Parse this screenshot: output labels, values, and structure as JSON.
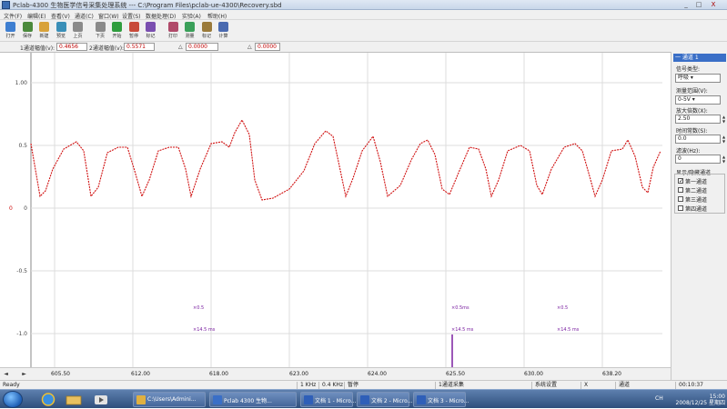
{
  "window": {
    "title": "Pclab-4300 生物医学信号采集处理系统 --- C:\\Program Files\\pclab-ue-4300\\Recovery.sbd",
    "minimize": "_",
    "maximize": "□",
    "close": "X"
  },
  "menu": [
    "文件(F)",
    "编辑(E)",
    "查看(V)",
    "通道(C)",
    "窗口(W)",
    "设置(S)",
    "数据处理(D)",
    "实验(A)",
    "帮助(H)"
  ],
  "toolbar": [
    {
      "label": "打开",
      "icon": "open-icon",
      "color": "#3f7fd1"
    },
    {
      "label": "保存",
      "icon": "save-icon",
      "color": "#4b8a3c"
    },
    {
      "label": "新建",
      "icon": "new-icon",
      "color": "#d8a23a"
    },
    {
      "label": "预览",
      "icon": "preview-icon",
      "color": "#3a8fb8"
    },
    {
      "label": "上页",
      "icon": "prev-page-icon",
      "color": "#8a8a8a"
    },
    {
      "label": "下页",
      "icon": "next-page-icon",
      "color": "#8a8a8a"
    },
    {
      "label": "开始",
      "icon": "start-icon",
      "color": "#2f9d3e"
    },
    {
      "label": "暂停",
      "icon": "pause-icon",
      "color": "#c84a3a"
    },
    {
      "label": "标记",
      "icon": "mark-icon",
      "color": "#7a4fb0"
    },
    {
      "label": "打印",
      "icon": "print-icon",
      "color": "#b04a6a"
    },
    {
      "label": "测量",
      "icon": "measure-icon",
      "color": "#3aa05a"
    },
    {
      "label": "标记",
      "icon": "flag-icon",
      "color": "#9a7a3a"
    },
    {
      "label": "计算",
      "icon": "calc-icon",
      "color": "#4a6ab0"
    }
  ],
  "params": {
    "channel_label": "1通道幅值(v):",
    "channel_value": "0.4656",
    "sample_label": "2通道幅值(v):",
    "sample_value": "0.5571",
    "field3_label": "△",
    "field3_value": "0.0000",
    "field4_label": "△",
    "field4_value": "0.0000"
  },
  "plot": {
    "y_ticks": [
      "1.00",
      "0.5",
      "0",
      "-0.5",
      "-1.0"
    ],
    "baseline_marker": "0",
    "trace_color": "#d01010",
    "grid_color": "#dcdcdc",
    "mark_color": "#7a1fa0",
    "markers": [
      {
        "top": "×0.5",
        "bottom": "×14.5 ms"
      },
      {
        "top": "×0.5ms",
        "bottom": "×14.5 ms"
      },
      {
        "top": "×0.5",
        "bottom": "×14.5 ms"
      }
    ]
  },
  "chart_data": {
    "type": "line",
    "x_ticks": [
      "605.50",
      "612.00",
      "618.00",
      "623.00",
      "624.00",
      "625.50",
      "630.00",
      "638.20"
    ],
    "y_ticks": [
      "1.00",
      "0.5",
      "0",
      "-0.5",
      "-1.0"
    ]
  },
  "xaxis": {
    "scroll_left": "◄",
    "scroll_right": "►",
    "ticks": [
      "605.50",
      "612.00",
      "618.00",
      "623.00",
      "624.00",
      "625.50",
      "630.00",
      "638.20"
    ]
  },
  "right_panel": {
    "header": "一 通道 1",
    "signal_type_label": "信号类型:",
    "signal_type_value": "呼吸 ▾",
    "range_label": "测量范围(V):",
    "range_value": "0-5V ▾",
    "gain_label": "放大倍数(X):",
    "gain_value": "2.50",
    "time_const_label": "时间常数(S):",
    "time_const_value": "0.0",
    "filter_label": "滤波(Hz):",
    "filter_value": "0",
    "display_group_label": "显示/隐藏通道",
    "channels": [
      {
        "label": "第一通道",
        "checked": "✓"
      },
      {
        "label": "第二通道",
        "checked": ""
      },
      {
        "label": "第三通道",
        "checked": ""
      },
      {
        "label": "第四通道",
        "checked": ""
      }
    ]
  },
  "status": {
    "ready": "Ready",
    "s1": "1 KHz",
    "s2": "0.4 KHz",
    "s3": "暂停",
    "s4": "1通道采集",
    "s5": "系统设置",
    "s6": "X",
    "s7": "通道",
    "s8": "00:10:37"
  },
  "taskbar": {
    "items": [
      {
        "label": "C:\\Users\\Admini...",
        "color": "#e0b040"
      },
      {
        "label": "Pclab 4300 生物...",
        "color": "#3a6fc7"
      },
      {
        "label": "文档 1 - Micro...",
        "color": "#2f5fb8"
      },
      {
        "label": "文档 2 - Micro...",
        "color": "#2f5fb8"
      },
      {
        "label": "文档 3 - Micro...",
        "color": "#2f5fb8"
      }
    ],
    "time": "15:00",
    "date": "2008/12/25 星期四",
    "lang": "CH"
  }
}
